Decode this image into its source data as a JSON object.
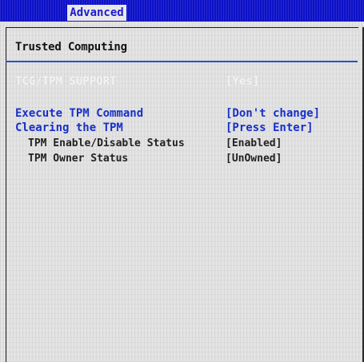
{
  "menubar": {
    "active_tab": "Advanced"
  },
  "page": {
    "title": "Trusted Computing"
  },
  "items": [
    {
      "label": "TCG/TPM SUPPORT",
      "value": "[Yes]",
      "state": "disabled"
    },
    {
      "label": "Execute TPM Command",
      "value": "[Don't change]",
      "state": "selectable"
    },
    {
      "label": "Clearing the TPM",
      "value": "[Press Enter]",
      "state": "selectable"
    },
    {
      "label": "TPM Enable/Disable Status",
      "value": "[Enabled]",
      "state": "info"
    },
    {
      "label": "TPM Owner Status",
      "value": "[UnOwned]",
      "state": "info"
    }
  ],
  "colors": {
    "menubar_bg": "#0d11c8",
    "tab_text": "#1b1bd0",
    "selectable_text": "#1730c8",
    "info_text": "#222222",
    "disabled_text": "#f4f4f4",
    "rule": "#2b4fc7"
  }
}
